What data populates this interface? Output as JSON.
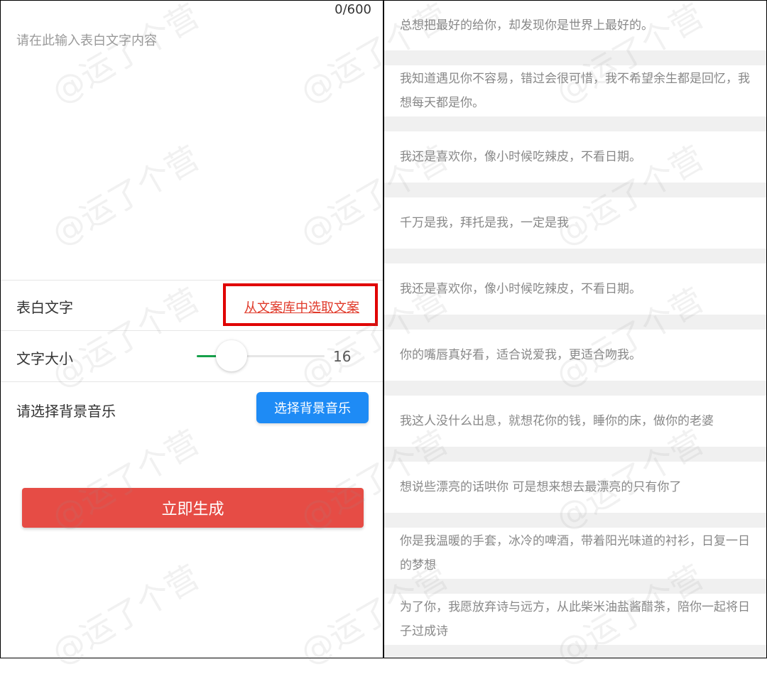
{
  "editor": {
    "counter": "0/600",
    "placeholder": "请在此输入表白文字内容"
  },
  "settings": {
    "confession_text_label": "表白文字",
    "pick_from_library_link": "从文案库中选取文案",
    "font_size_label": "文字大小",
    "font_size_value": "16",
    "font_size_slider_fraction": 0.27,
    "bg_music_label": "请选择背景音乐",
    "bg_music_button": "选择背景音乐"
  },
  "actions": {
    "generate_button": "立即生成"
  },
  "library": {
    "quotes": [
      "总想把最好的给你，却发现你是世界上最好的。",
      "我知道遇见你不容易，错过会很可惜，我不希望余生都是回忆，我想每天都是你。",
      "我还是喜欢你，像小时候吃辣皮，不看日期。",
      "千万是我，拜托是我，一定是我",
      "我还是喜欢你，像小时候吃辣皮，不看日期。",
      "你的嘴唇真好看，适合说爱我，更适合吻我。",
      "我这人没什么出息，就想花你的钱，睡你的床，做你的老婆",
      "想说些漂亮的话哄你 可是想来想去最漂亮的只有你了",
      "你是我温暖的手套，冰冷的啤酒，带着阳光味道的衬衫，日复一日的梦想",
      "为了你，我愿放弃诗与远方，从此柴米油盐酱醋茶，陪你一起将日子过成诗"
    ]
  },
  "watermark": "@运了个营",
  "colors": {
    "primary_blue": "#1e8bf5",
    "generate_red": "#e64c45",
    "link_red": "#e03a2a",
    "highlight_border": "#e00000",
    "slider_green": "#16a04a"
  }
}
